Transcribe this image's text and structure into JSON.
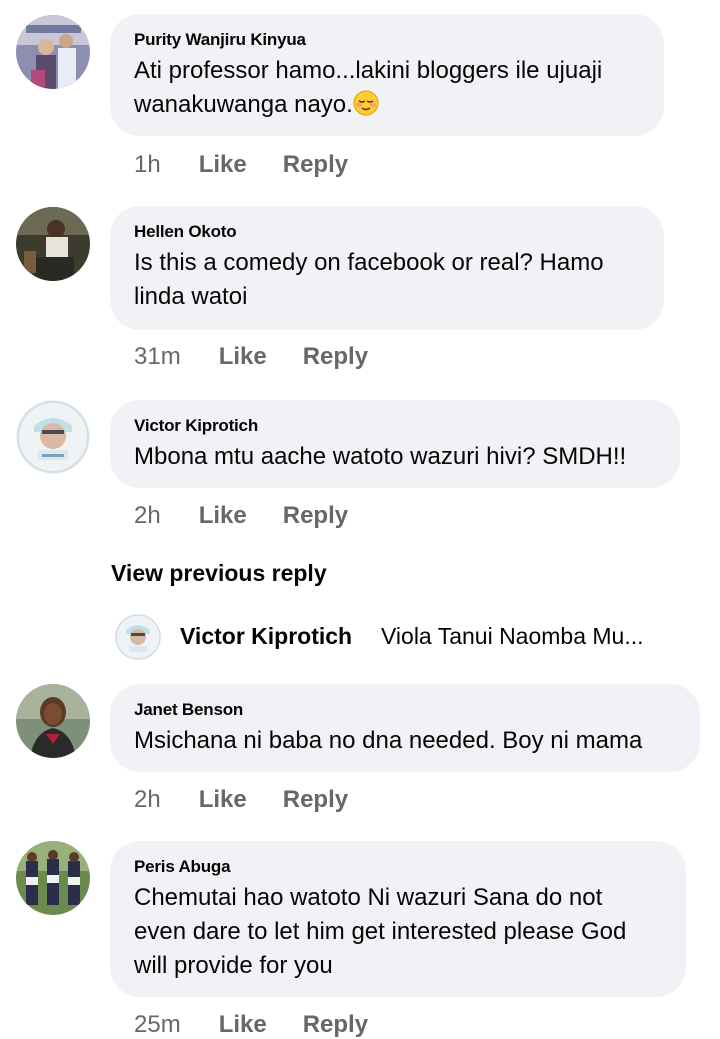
{
  "comments": [
    {
      "author": "Purity Wanjiru Kinyua",
      "text_line1": "Ati professor hamo...lakini bloggers ile ujuaji",
      "text_line2": "wanakuwanga nayo.",
      "emoji": "relieved-face-icon",
      "time": "1h",
      "like": "Like",
      "reply": "Reply"
    },
    {
      "author": "Hellen Okoto",
      "text_line1": "Is this a comedy on facebook or real? Hamo",
      "text_line2": "linda watoi",
      "time": "31m",
      "like": "Like",
      "reply": "Reply"
    },
    {
      "author": "Victor Kiprotich",
      "text_line1": "Mbona mtu aache watoto wazuri hivi? SMDH!!",
      "time": "2h",
      "like": "Like",
      "reply": "Reply",
      "view_previous": "View previous reply",
      "reply_preview": {
        "author": "Victor Kiprotich",
        "snippet": "Viola Tanui Naomba Mu..."
      }
    },
    {
      "author": "Janet Benson",
      "text_line1": "Msichana ni baba no dna needed. Boy ni mama",
      "time": "2h",
      "like": "Like",
      "reply": "Reply"
    },
    {
      "author": "Peris Abuga",
      "text_line1": "Chemutai hao watoto Ni wazuri Sana do not",
      "text_line2": "even dare to let him get interested please God",
      "text_line3": "will provide for you",
      "time": "25m",
      "like": "Like",
      "reply": "Reply"
    }
  ],
  "colors": {
    "bubble": "#f0f2f5",
    "meta": "#65676b",
    "text": "#050505"
  }
}
